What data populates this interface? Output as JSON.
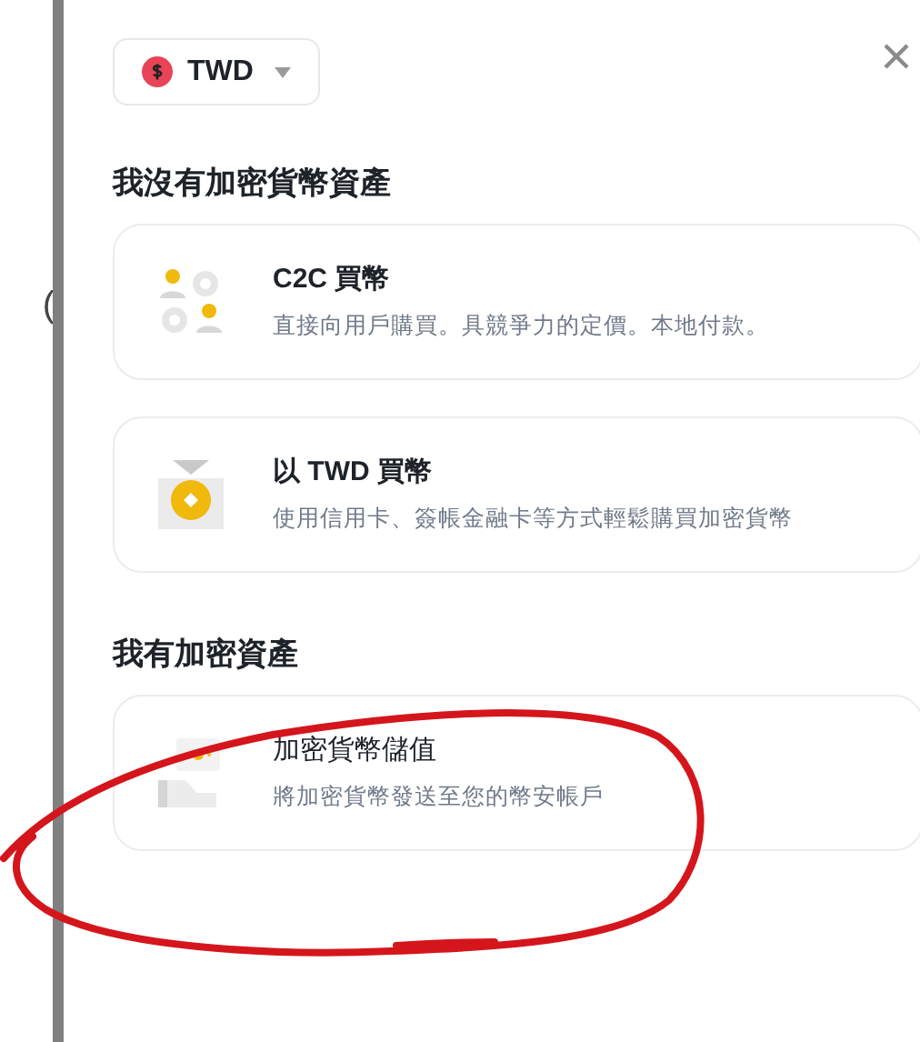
{
  "edge_text": "(",
  "currency": {
    "code": "TWD"
  },
  "sections": [
    {
      "heading": "我沒有加密貨幣資產",
      "options": [
        {
          "kind": "c2c",
          "title": "C2C 買幣",
          "description": "直接向用戶購買。具競爭力的定價。本地付款。"
        },
        {
          "kind": "card",
          "title": "以 TWD 買幣",
          "description": "使用信用卡、簽帳金融卡等方式輕鬆購買加密貨幣"
        }
      ]
    },
    {
      "heading": "我有加密資產",
      "options": [
        {
          "kind": "deposit",
          "title": "加密貨幣儲值",
          "description": "將加密貨幣發送至您的幣安帳戶"
        }
      ]
    }
  ]
}
